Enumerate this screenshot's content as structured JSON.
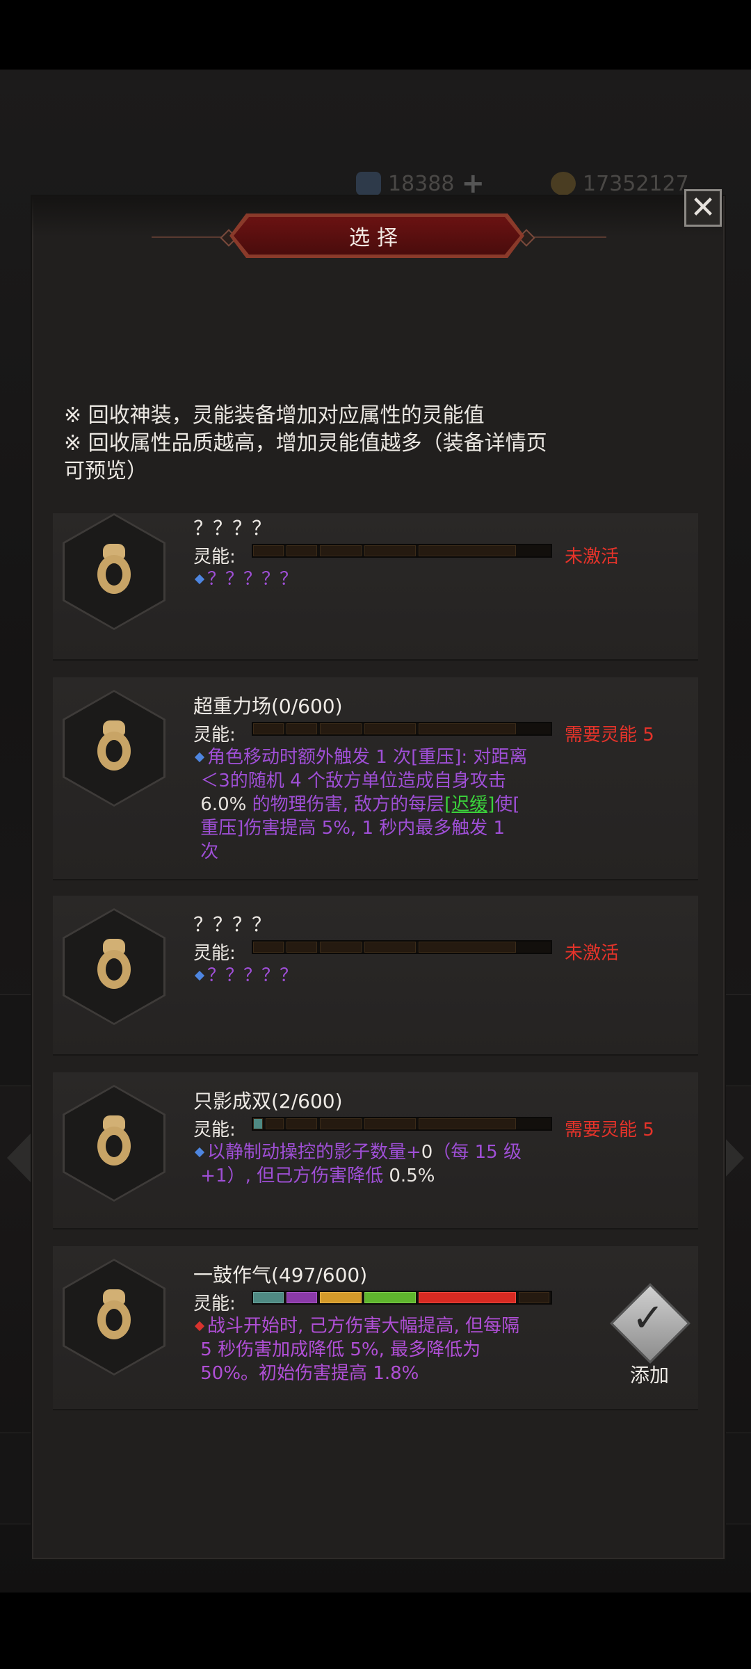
{
  "background": {
    "currency_gem": "18388",
    "currency_gold": "17352127"
  },
  "modal": {
    "title": "选择",
    "close_label": "✕",
    "notes": [
      "※ 回收神装，灵能装备增加对应属性的灵能值",
      "※ 回收属性品质越高，增加灵能值越多（装备详情页",
      "可预览）"
    ],
    "energy_label": "灵能:",
    "items": [
      {
        "name": "？？？？",
        "status": "未激活",
        "desc": "？？？？？",
        "progress": 0
      },
      {
        "name": "超重力场(0/600)",
        "status": "需要灵能 5",
        "desc_parts": [
          "角色移动时额外触发 1 次[重压]: 对距离",
          "＜3的随机 4 个敌方单位造成自身攻击",
          "6.0%",
          " 的物理伤害, 敌方的每层",
          "[迟缓]",
          "使[",
          "重压]伤害提高 5%, 1 秒内最多触发 1",
          "次"
        ],
        "progress": 0
      },
      {
        "name": "？？？？",
        "status": "未激活",
        "desc": "？？？？？",
        "progress": 0
      },
      {
        "name": "只影成双(2/600)",
        "status": "需要灵能 5",
        "desc_parts": [
          "以静制动操控的影子数量+",
          "0",
          "（每 15 级",
          "+1）, 但己方伤害降低 ",
          "0.5%"
        ],
        "progress": 0.003
      },
      {
        "name": "一鼓作气(497/600)",
        "desc_parts": [
          "战斗开始时, 己方伤害大幅提高, 但每隔",
          "5 秒伤害加成降低 5%, 最多降低为",
          "50%。初始伤害提高 ",
          "1.8%"
        ],
        "progress": 0.828,
        "add_label": "添加"
      }
    ]
  },
  "colors": {
    "status_red": "#e5332a",
    "desc_purple": "#9f4fd6",
    "highlight_green": "#3bd23b",
    "seg_teal": "#4f8a83",
    "seg_purple": "#8a3aa8",
    "seg_orange": "#d49a2a",
    "seg_green": "#5fb52e",
    "seg_red": "#d72a22"
  }
}
